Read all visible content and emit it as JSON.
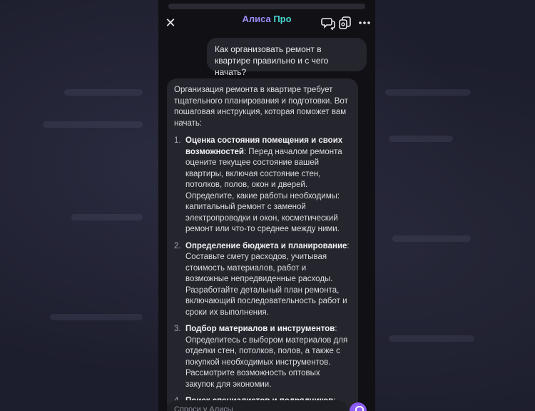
{
  "header": {
    "title_main": "Алиса",
    "title_pro": "Про"
  },
  "icons": {
    "close": "close-icon",
    "chats": "chats-icon",
    "copy": "copy-icon",
    "more": "more-icon",
    "mic": "mic-icon"
  },
  "colors": {
    "background": "#101015",
    "bubble": "#25252d",
    "title_accent": "#9a8cf5",
    "pro_accent": "#47d6d0",
    "mic": "#8b5cf6"
  },
  "user_message": "Как организовать ремонт в квартире правильно и с чего начать?",
  "bot_message": {
    "intro": "Организация ремонта в квартире требует тщательного планирования и подготовки. Вот пошаговая инструкция, которая поможет вам начать:",
    "steps": [
      {
        "num": "1.",
        "title": "Оценка состояния помещения и своих возможностей",
        "text": ": Перед началом ремонта оцените текущее состояние вашей квартиры, включая состояние стен, потолков, полов, окон и дверей. Определите, какие работы необходимы: капитальный ремонт с заменой электропроводки и окон, косметический ремонт или что-то среднее между ними."
      },
      {
        "num": "2.",
        "title": "Определение бюджета и планирование",
        "text": ": Составьте смету расходов, учитывая стоимость материалов, работ и возможные непредвиденные расходы. Разработайте детальный план ремонта, включающий последовательность работ и сроки их выполнения."
      },
      {
        "num": "3.",
        "title": "Подбор материалов и инструментов",
        "text": ": Определитесь с выбором материалов для отделки стен, потолков, полов, а также с покупкой необходимых инструментов. Рассмотрите возможность оптовых закупок для экономии."
      },
      {
        "num": "4.",
        "title": "Поиск специалистов и подрядчиков",
        "text": ":"
      }
    ]
  },
  "input": {
    "placeholder": "Спроси у Алисы"
  }
}
